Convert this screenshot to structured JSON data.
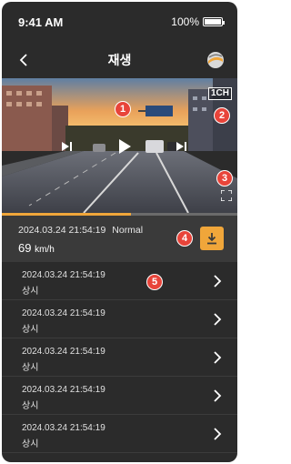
{
  "status_bar": {
    "time": "9:41 AM",
    "battery": "100%"
  },
  "nav": {
    "title": "재생",
    "back_icon": "chevron-left-icon",
    "logo_icon": "brand-logo-icon"
  },
  "video": {
    "channel": "1CH",
    "markers": [
      "1",
      "2",
      "3"
    ]
  },
  "playback_progress_fraction": 0.55,
  "info": {
    "datetime": "2024.03.24 21:54:19",
    "mode": "Normal",
    "speed_value": "69",
    "speed_unit": "km/h",
    "marker": "4"
  },
  "list_marker": "5",
  "recordings": [
    {
      "datetime": "2024.03.24 21:54:19",
      "type": "상시"
    },
    {
      "datetime": "2024.03.24 21:54:19",
      "type": "상시"
    },
    {
      "datetime": "2024.03.24 21:54:19",
      "type": "상시"
    },
    {
      "datetime": "2024.03.24 21:54:19",
      "type": "상시"
    },
    {
      "datetime": "2024.03.24 21:54:19",
      "type": "상시"
    }
  ],
  "colors": {
    "accent": "#f0a63a",
    "marker": "#e8443a",
    "background": "#2b2b2b"
  }
}
